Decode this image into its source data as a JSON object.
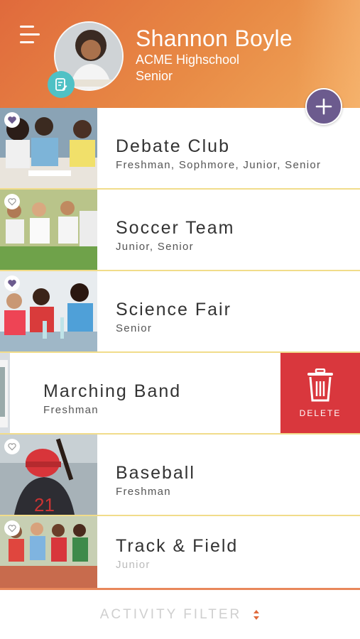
{
  "profile": {
    "name": "Shannon Boyle",
    "school": "ACME Highschool",
    "year": "Senior"
  },
  "activities": [
    {
      "title": "Debate Club",
      "grades": "Freshman, Sophmore, Junior, Senior",
      "favorited": true
    },
    {
      "title": "Soccer Team",
      "grades": "Junior, Senior",
      "favorited": false
    },
    {
      "title": "Science Fair",
      "grades": "Senior",
      "favorited": true
    },
    {
      "title": "Marching Band",
      "grades": "Freshman",
      "favorited": false,
      "swiped": true
    },
    {
      "title": "Baseball",
      "grades": "Freshman",
      "favorited": false
    },
    {
      "title": "Track & Field",
      "grades": "Junior",
      "favorited": false
    }
  ],
  "delete_label": "DELETE",
  "footer": {
    "filter_label": "ACTIVITY FILTER"
  },
  "colors": {
    "header": "#e47a3f",
    "accent_purple": "#6c5b8e",
    "badge_teal": "#4fc1c5",
    "delete_red": "#d9373d",
    "divider_yellow": "#f1dc8a",
    "footer_border": "#e8875a"
  },
  "icons": {
    "menu": "hamburger-menu-icon",
    "badge": "document-edit-icon",
    "add": "plus-icon",
    "favorite": "heart-icon",
    "delete": "trash-icon",
    "filter": "sort-arrows-icon"
  }
}
